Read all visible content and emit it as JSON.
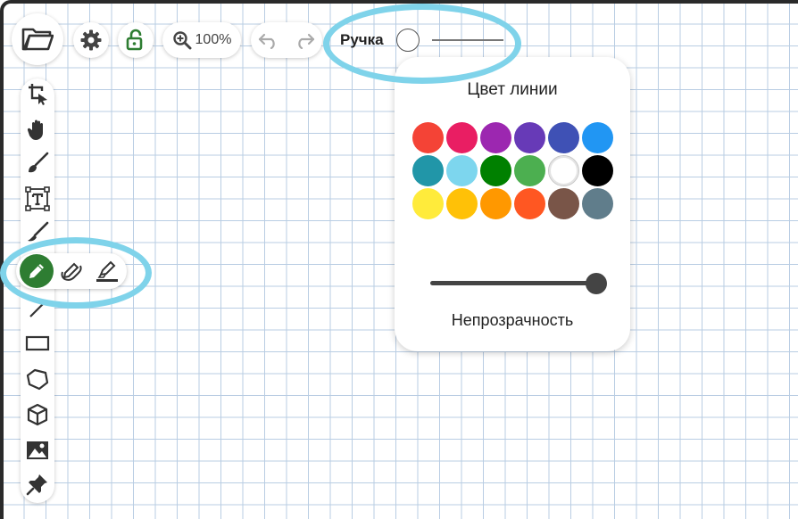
{
  "topbar": {
    "zoom_label": "100%",
    "pen_label": "Ручка"
  },
  "icons": {
    "open": "folder-open-icon",
    "settings": "gear-icon",
    "lock": "unlock-icon",
    "zoom": "zoom-in-icon",
    "undo": "undo-icon",
    "redo": "redo-icon"
  },
  "toolbar": {
    "tools": [
      "crop-select-icon",
      "hand-icon",
      "brush-icon",
      "text-box-icon",
      "eraser-icon",
      "pen-icon",
      "line-icon",
      "rectangle-icon",
      "polygon-icon",
      "cube-icon",
      "image-icon",
      "pin-icon"
    ]
  },
  "pen_tools": {
    "items": [
      "pen-icon",
      "smooth-pen-icon",
      "highlighter-icon"
    ],
    "active_color": "#2e7d32"
  },
  "color_panel": {
    "title": "Цвет линии",
    "colors": [
      "#f44336",
      "#e91e63",
      "#9c27b0",
      "#673ab7",
      "#3f51b5",
      "#2196f3",
      "#2196a8",
      "#7dd6ee",
      "#008000",
      "#4caf50",
      "#ffffff",
      "#000000",
      "#ffeb3b",
      "#ffc107",
      "#ff9800",
      "#ff5722",
      "#795548",
      "#607d8b"
    ],
    "selected_color": "#ffffff",
    "opacity_label": "Непрозрачность",
    "opacity_value": 1.0
  },
  "highlight_color": "#7fd3ea"
}
